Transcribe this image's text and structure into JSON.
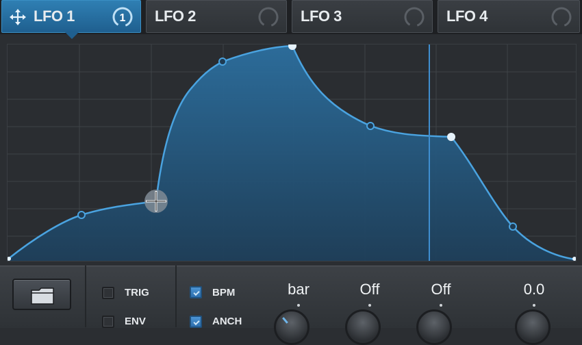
{
  "tabs": [
    {
      "label": "LFO 1",
      "badge": "1",
      "active": true
    },
    {
      "label": "LFO 2",
      "active": false
    },
    {
      "label": "LFO 3",
      "active": false
    },
    {
      "label": "LFO 4",
      "active": false
    }
  ],
  "controls": {
    "trig_label": "TRIG",
    "env_label": "ENV",
    "bpm_label": "BPM",
    "anch_label": "ANCH",
    "knob1_value": "bar",
    "knob2_value": "Off",
    "knob3_value": "Off",
    "knob4_value": "0.0"
  },
  "colors": {
    "accent": "#4aa3e0",
    "tab_active": "#2a73a8",
    "background": "#2b2e32"
  }
}
